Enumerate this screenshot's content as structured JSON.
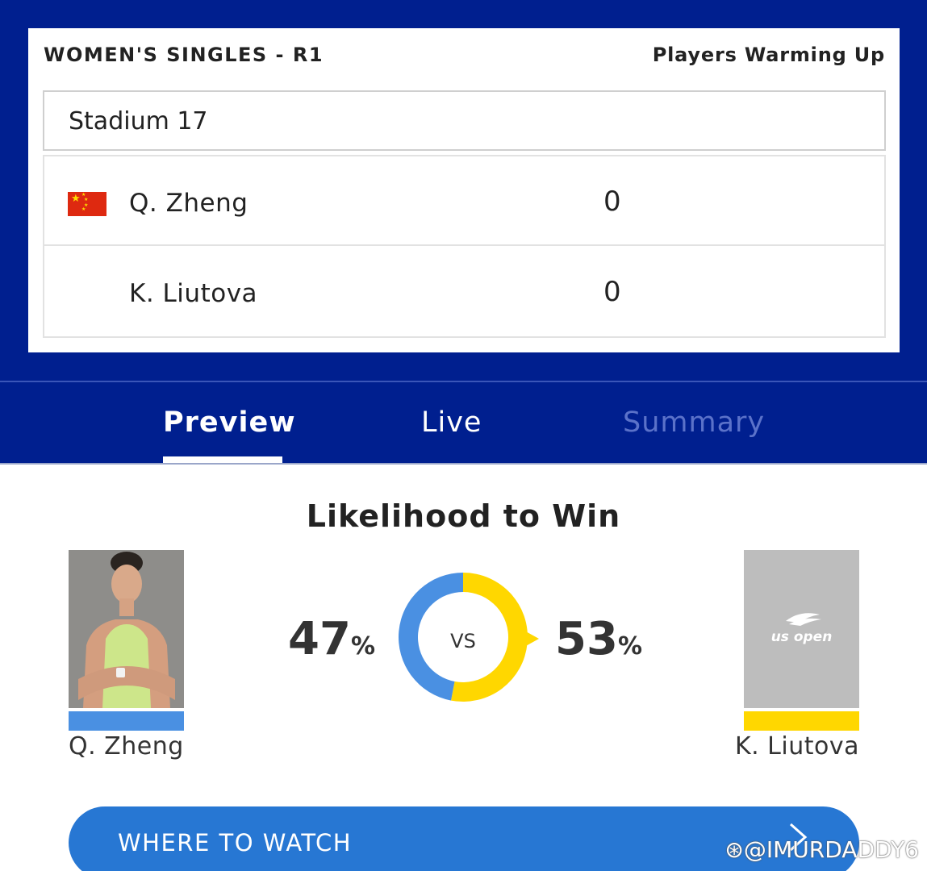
{
  "match": {
    "event": "WOMEN'S SINGLES - R1",
    "status": "Players Warming Up",
    "court": "Stadium 17",
    "players": [
      {
        "name": "Q. Zheng",
        "score": "0",
        "flag": "china-flag-icon"
      },
      {
        "name": "K. Liutova",
        "score": "0"
      }
    ]
  },
  "tabs": [
    {
      "label": "Preview",
      "active": true
    },
    {
      "label": "Live",
      "active": false
    },
    {
      "label": "Summary",
      "active": false
    }
  ],
  "likelihood": {
    "title": "Likelihood to Win",
    "player1": {
      "name": "Q. Zheng",
      "percent": "47",
      "percent_value": 47,
      "color": "#4a90e2"
    },
    "player2": {
      "name": "K. Liutova",
      "percent": "53",
      "percent_value": 53,
      "color": "#ffd700"
    },
    "percent_sign": "%",
    "vs": "VS",
    "placeholder_logo": "us open"
  },
  "cta": {
    "label": "WHERE TO WATCH",
    "icon": "chevron-right-icon"
  },
  "watermark": "@IMURDADDY6",
  "colors": {
    "brand_navy": "#001f8f",
    "cta_blue": "#2777d3",
    "tab_inactive": "#5b72c9"
  }
}
